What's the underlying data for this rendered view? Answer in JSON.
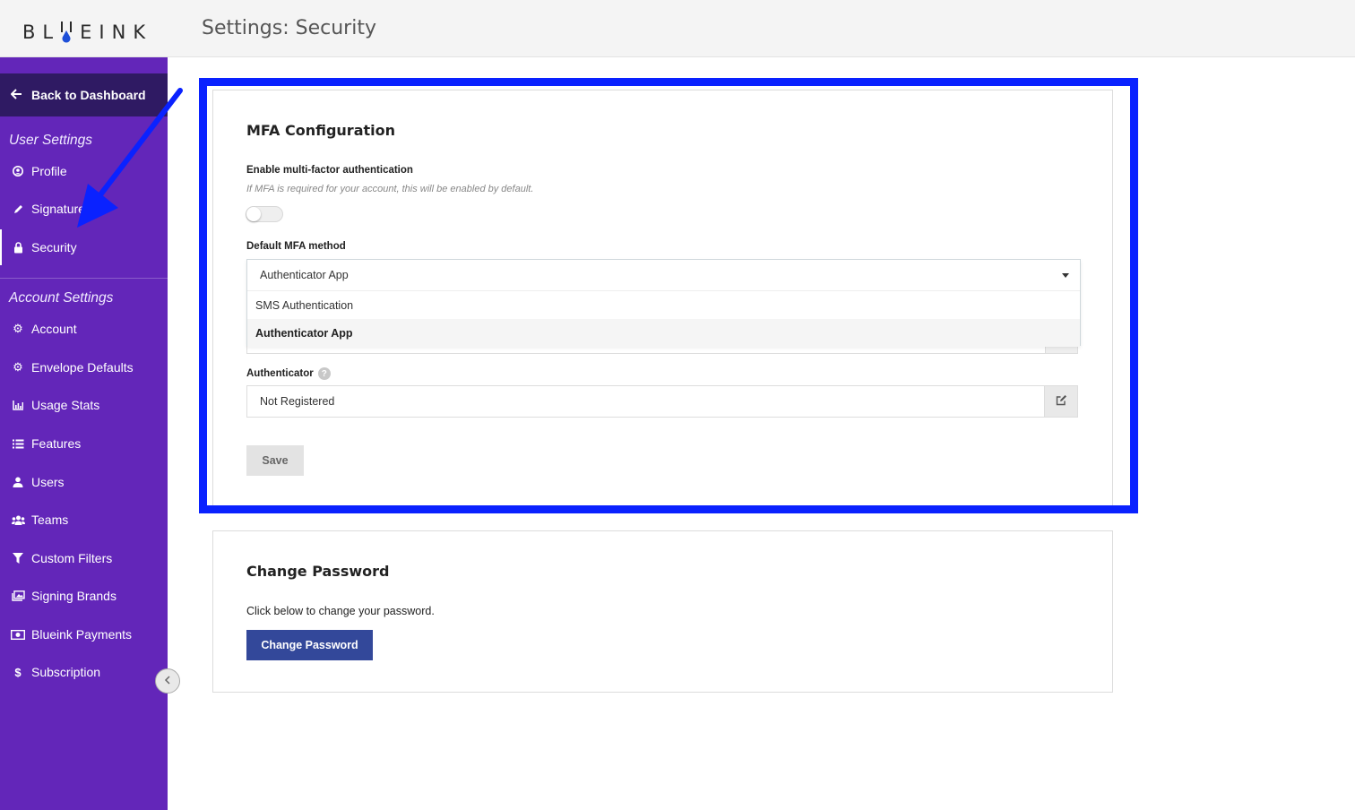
{
  "header": {
    "logo_text": "BLUEINK",
    "page_title": "Settings: Security"
  },
  "sidebar": {
    "back_label": "Back to Dashboard",
    "user_settings_title": "User Settings",
    "user_items": [
      {
        "label": "Profile",
        "icon": "user-circle-icon"
      },
      {
        "label": "Signature",
        "icon": "pen-icon"
      },
      {
        "label": "Security",
        "icon": "lock-icon",
        "active": true
      }
    ],
    "account_settings_title": "Account Settings",
    "account_items": [
      {
        "label": "Account",
        "icon": "gear-icon"
      },
      {
        "label": "Envelope Defaults",
        "icon": "gears-icon"
      },
      {
        "label": "Usage Stats",
        "icon": "bar-chart-icon"
      },
      {
        "label": "Features",
        "icon": "list-icon"
      },
      {
        "label": "Users",
        "icon": "user-icon"
      },
      {
        "label": "Teams",
        "icon": "users-icon"
      },
      {
        "label": "Custom Filters",
        "icon": "filter-icon"
      },
      {
        "label": "Signing Brands",
        "icon": "images-icon"
      },
      {
        "label": "Blueink Payments",
        "icon": "money-icon"
      },
      {
        "label": "Subscription",
        "icon": "dollar-icon"
      }
    ]
  },
  "mfa": {
    "title": "MFA Configuration",
    "enable_label": "Enable multi-factor authentication",
    "enable_hint": "If MFA is required for your account, this will be enabled by default.",
    "toggle_on": false,
    "method_label": "Default MFA method",
    "method_current": "Authenticator App",
    "method_options": [
      "SMS Authentication",
      "Authenticator App"
    ],
    "authenticator_label": "Authenticator",
    "authenticator_value": "Not Registered",
    "save_label": "Save"
  },
  "password": {
    "title": "Change Password",
    "description": "Click below to change your password.",
    "button_label": "Change Password"
  },
  "colors": {
    "sidebar": "#6326b9",
    "sidebar_dark": "#2f1a63",
    "highlight": "#0a22ff",
    "primary_button": "#33489a"
  }
}
